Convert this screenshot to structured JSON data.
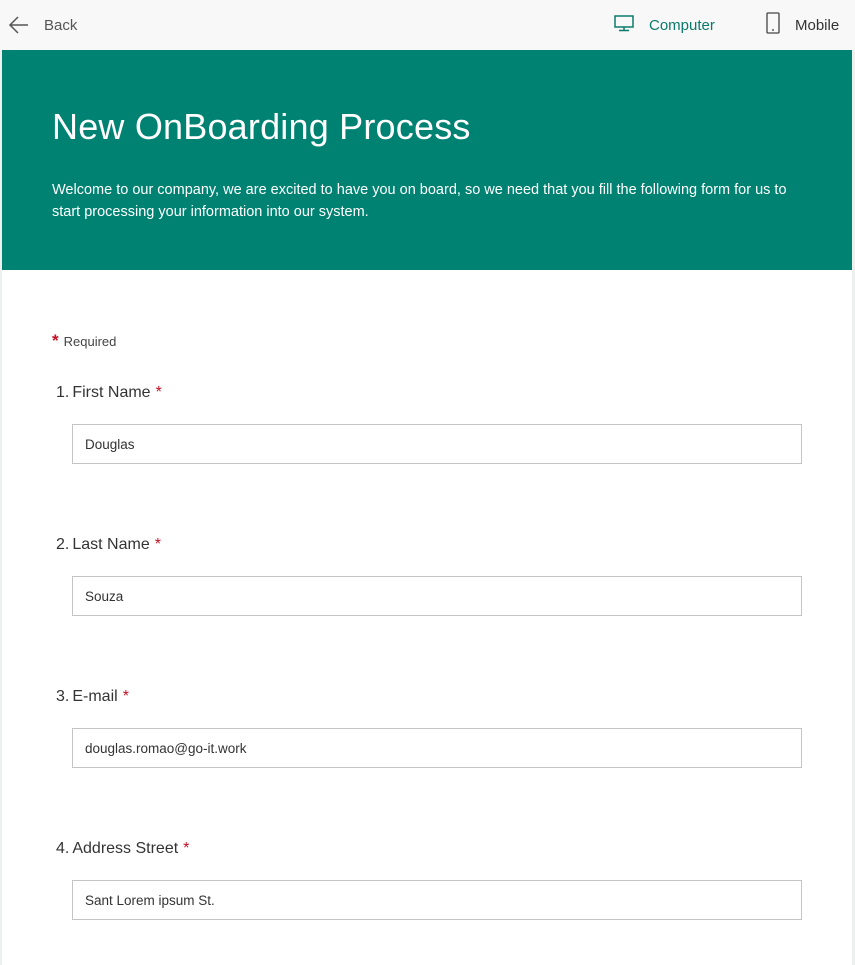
{
  "topbar": {
    "back_label": "Back",
    "computer_label": "Computer",
    "mobile_label": "Mobile",
    "active_color": "#0b7a6b"
  },
  "form": {
    "title": "New OnBoarding Process",
    "description": "Welcome to our company, we are excited to have you on board, so we need that you fill the following form for us to start processing your information into our system.",
    "banner_color": "#008272",
    "required_marker": "*",
    "required_label": "Required",
    "questions": [
      {
        "number": "1.",
        "label": "First Name",
        "value": "Douglas"
      },
      {
        "number": "2.",
        "label": "Last Name",
        "value": "Souza"
      },
      {
        "number": "3.",
        "label": "E-mail",
        "value": "douglas.romao@go-it.work"
      },
      {
        "number": "4.",
        "label": "Address Street",
        "value": "Sant Lorem ipsum St."
      }
    ]
  }
}
